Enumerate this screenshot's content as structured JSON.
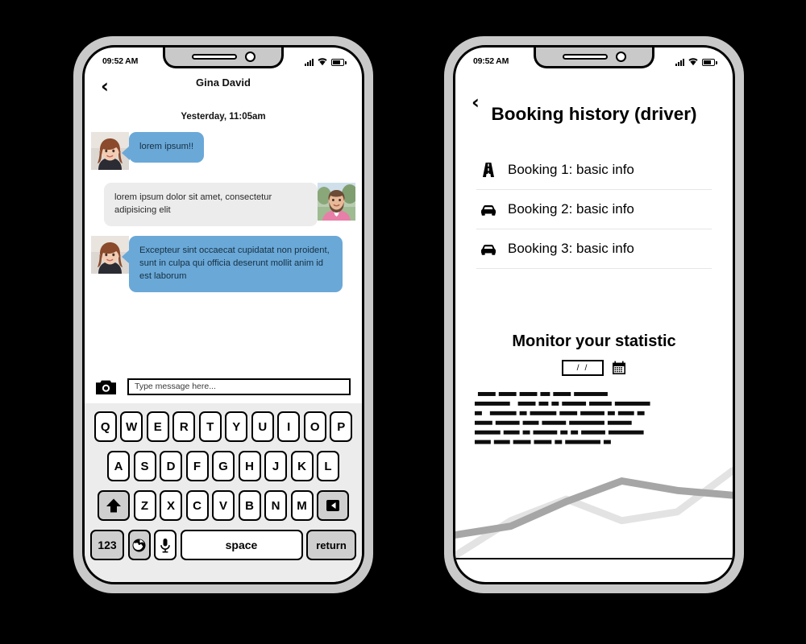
{
  "chat_phone": {
    "status": {
      "time": "09:52 AM",
      "signal_icon": "signal-bars-icon",
      "wifi_icon": "wifi-icon",
      "battery_icon": "battery-icon"
    },
    "back_label": "‹",
    "title": "Gina David",
    "daystamp": "Yesterday, 11:05am",
    "messages": [
      {
        "side": "them",
        "avatar": "woman-avatar",
        "text": "lorem ipsum!!"
      },
      {
        "side": "me",
        "avatar": "man-avatar",
        "text": "lorem ipsum dolor sit amet, consectetur adipisicing elit"
      },
      {
        "side": "them",
        "avatar": "woman-avatar",
        "text": "Excepteur sint occaecat cupidatat non proident, sunt in culpa qui officia deserunt mollit anim id est laborum"
      }
    ],
    "composer": {
      "camera_icon": "camera-icon",
      "input_value": "",
      "input_placeholder": "Type message here..."
    },
    "keyboard": {
      "row1": [
        "Q",
        "W",
        "E",
        "R",
        "T",
        "Y",
        "U",
        "I",
        "O",
        "P"
      ],
      "row2": [
        "A",
        "S",
        "D",
        "F",
        "G",
        "H",
        "J",
        "K",
        "L"
      ],
      "row3_letters": [
        "Z",
        "X",
        "C",
        "V",
        "B",
        "N",
        "M"
      ],
      "shift_icon": "shift-arrow-icon",
      "backspace_icon": "backspace-icon",
      "numbers_label": "123",
      "globe_icon": "globe-icon",
      "mic_icon": "microphone-icon",
      "space_label": "space",
      "return_label": "return"
    }
  },
  "booking_phone": {
    "status": {
      "time": "09:52 AM",
      "signal_icon": "signal-bars-icon",
      "wifi_icon": "wifi-icon",
      "battery_icon": "battery-icon"
    },
    "back_label": "‹",
    "title": "Booking history (driver)",
    "bookings": [
      {
        "icon": "road-icon",
        "label": "Booking 1: basic info"
      },
      {
        "icon": "car-icon",
        "label": "Booking 2: basic info"
      },
      {
        "icon": "car-icon",
        "label": "Booking 3: basic info"
      }
    ],
    "statistics": {
      "title": "Monitor your statistic",
      "date_value": "/  /",
      "calendar_icon": "calendar-icon",
      "body_text_note": "illegible greeked placeholder paragraph, 6 lines"
    }
  },
  "chart_data": {
    "type": "line",
    "title": "",
    "xlabel": "",
    "ylabel": "",
    "grid": false,
    "legend": "none",
    "x": [
      0,
      1,
      2,
      3,
      4,
      5
    ],
    "series": [
      {
        "name": "series-dark",
        "color": "#a6a6a6",
        "values": [
          22,
          30,
          54,
          74,
          64,
          58
        ]
      },
      {
        "name": "series-light",
        "color": "#e3e3e3",
        "values": [
          2,
          36,
          56,
          38,
          46,
          80
        ]
      }
    ],
    "ylim": [
      0,
      100
    ],
    "xlim": [
      0,
      5
    ]
  },
  "colors": {
    "bubble_blue": "#6aa8d8",
    "bubble_gray": "#ececec",
    "keyboard_bg": "#ececec",
    "key_shade": "#cfcfcf",
    "bezel": "#c9c9c9",
    "page_bg": "#000000"
  }
}
